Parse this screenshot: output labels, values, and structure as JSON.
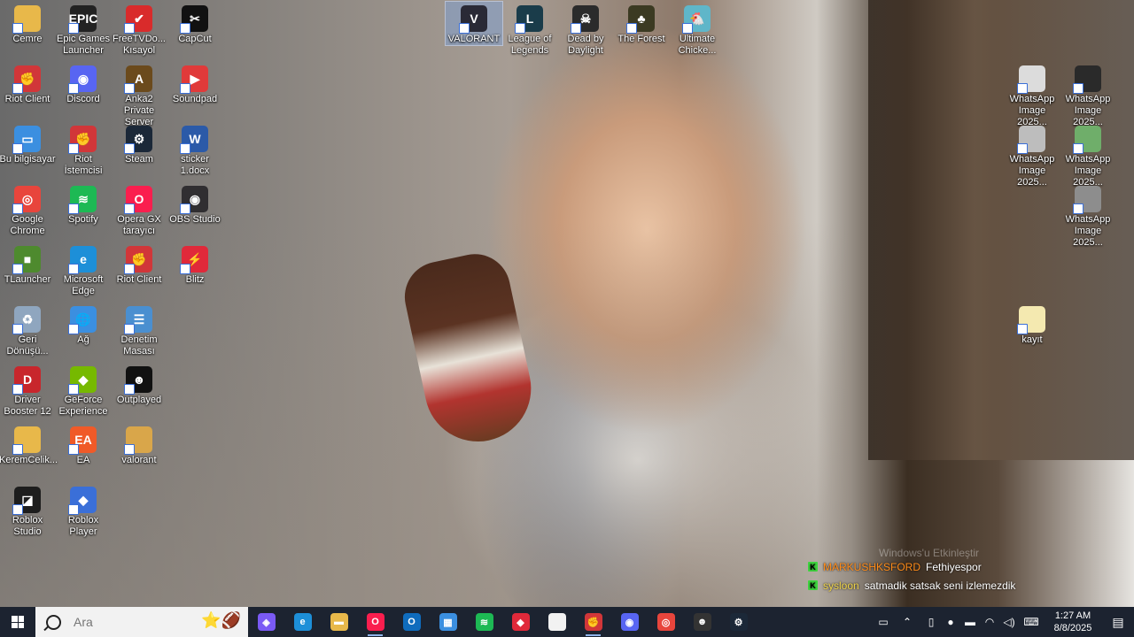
{
  "desktop": {
    "icons": [
      {
        "label": "Cemre",
        "icon": "folder-icon",
        "color": "#e8b84a",
        "glyph": "",
        "x": 0,
        "y": 0
      },
      {
        "label": "Epic Games Launcher",
        "icon": "epic-games-icon",
        "color": "#222222",
        "glyph": "EPIC",
        "x": 1,
        "y": 0
      },
      {
        "label": "FreeTVDo... Kısayol",
        "icon": "freetv-icon",
        "color": "#d92b2b",
        "glyph": "✔",
        "x": 2,
        "y": 0
      },
      {
        "label": "CapCut",
        "icon": "capcut-icon",
        "color": "#111111",
        "glyph": "✂",
        "x": 3,
        "y": 0
      },
      {
        "label": "VALORANT",
        "icon": "valorant-icon",
        "color": "#2a2a36",
        "glyph": "V",
        "x": 8,
        "y": 0,
        "selected": true
      },
      {
        "label": "League of Legends",
        "icon": "league-icon",
        "color": "#1a3c4a",
        "glyph": "L",
        "x": 9,
        "y": 0
      },
      {
        "label": "Dead by Daylight",
        "icon": "dbd-icon",
        "color": "#2b2b2b",
        "glyph": "☠",
        "x": 10,
        "y": 0
      },
      {
        "label": "The Forest",
        "icon": "the-forest-icon",
        "color": "#3b3a22",
        "glyph": "♣",
        "x": 11,
        "y": 0
      },
      {
        "label": "Ultimate Chicke...",
        "icon": "ultimate-chicken-icon",
        "color": "#5fb6c9",
        "glyph": "🐔",
        "x": 12,
        "y": 0
      },
      {
        "label": "Riot Client",
        "icon": "riot-client-icon",
        "color": "#d13639",
        "glyph": "✊",
        "x": 0,
        "y": 1
      },
      {
        "label": "Discord",
        "icon": "discord-icon",
        "color": "#5865f2",
        "glyph": "◉",
        "x": 1,
        "y": 1
      },
      {
        "label": "Anka2 Private Server",
        "icon": "anka2-icon",
        "color": "#6b4a1c",
        "glyph": "A",
        "x": 2,
        "y": 1
      },
      {
        "label": "Soundpad",
        "icon": "soundpad-icon",
        "color": "#e03a3a",
        "glyph": "▶",
        "x": 3,
        "y": 1
      },
      {
        "label": "Bu bilgisayar",
        "icon": "this-pc-icon",
        "color": "#3b8fe0",
        "glyph": "▭",
        "x": 0,
        "y": 2
      },
      {
        "label": "Riot İstemcisi",
        "icon": "riot-client-icon",
        "color": "#d13639",
        "glyph": "✊",
        "x": 1,
        "y": 2
      },
      {
        "label": "Steam",
        "icon": "steam-icon",
        "color": "#1b2838",
        "glyph": "⚙",
        "x": 2,
        "y": 2
      },
      {
        "label": "sticker 1.docx",
        "icon": "word-document-icon",
        "color": "#2b5aa8",
        "glyph": "W",
        "x": 3,
        "y": 2
      },
      {
        "label": "Google Chrome",
        "icon": "chrome-icon",
        "color": "#e8453c",
        "glyph": "◎",
        "x": 0,
        "y": 3
      },
      {
        "label": "Spotify",
        "icon": "spotify-icon",
        "color": "#1db954",
        "glyph": "≋",
        "x": 1,
        "y": 3
      },
      {
        "label": "Opera GX tarayıcı",
        "icon": "opera-gx-icon",
        "color": "#fa1e4e",
        "glyph": "O",
        "x": 2,
        "y": 3
      },
      {
        "label": "OBS Studio",
        "icon": "obs-icon",
        "color": "#302e31",
        "glyph": "◉",
        "x": 3,
        "y": 3
      },
      {
        "label": "TLauncher",
        "icon": "tlauncher-icon",
        "color": "#4e8a2e",
        "glyph": "■",
        "x": 0,
        "y": 4
      },
      {
        "label": "Microsoft Edge",
        "icon": "edge-icon",
        "color": "#1d8fd8",
        "glyph": "e",
        "x": 1,
        "y": 4
      },
      {
        "label": "Riot Client",
        "icon": "riot-client-icon",
        "color": "#d13639",
        "glyph": "✊",
        "x": 2,
        "y": 4
      },
      {
        "label": "Blitz",
        "icon": "blitz-icon",
        "color": "#e0293a",
        "glyph": "⚡",
        "x": 3,
        "y": 4
      },
      {
        "label": "Geri Dönüşü...",
        "icon": "recycle-bin-icon",
        "color": "#8fa6bf",
        "glyph": "♻",
        "x": 0,
        "y": 5
      },
      {
        "label": "Ağ",
        "icon": "network-icon",
        "color": "#3b8fe0",
        "glyph": "🌐",
        "x": 1,
        "y": 5
      },
      {
        "label": "Denetim Masası",
        "icon": "control-panel-icon",
        "color": "#4a8fd0",
        "glyph": "☰",
        "x": 2,
        "y": 5
      },
      {
        "label": "Driver Booster 12",
        "icon": "driver-booster-icon",
        "color": "#c8262c",
        "glyph": "D",
        "x": 0,
        "y": 6
      },
      {
        "label": "GeForce Experience",
        "icon": "geforce-icon",
        "color": "#76b900",
        "glyph": "◆",
        "x": 1,
        "y": 6
      },
      {
        "label": "Outplayed",
        "icon": "outplayed-icon",
        "color": "#111111",
        "glyph": "☻",
        "x": 2,
        "y": 6
      },
      {
        "label": "KeremCelik...",
        "icon": "folder-icon",
        "color": "#e8b84a",
        "glyph": "",
        "x": 0,
        "y": 7
      },
      {
        "label": "EA",
        "icon": "ea-icon",
        "color": "#f05a28",
        "glyph": "EA",
        "x": 1,
        "y": 7
      },
      {
        "label": "valorant",
        "icon": "folder-icon",
        "color": "#d9a64a",
        "glyph": "",
        "x": 2,
        "y": 7
      },
      {
        "label": "Roblox Studio",
        "icon": "roblox-studio-icon",
        "color": "#1d1d1d",
        "glyph": "◪",
        "x": 0,
        "y": 8
      },
      {
        "label": "Roblox Player",
        "icon": "roblox-player-icon",
        "color": "#3a6fd8",
        "glyph": "◆",
        "x": 1,
        "y": 8
      },
      {
        "label": "WhatsApp Image 2025...",
        "icon": "image-file-icon",
        "color": "#dcdcdc",
        "glyph": "",
        "x": 18,
        "y": 1
      },
      {
        "label": "WhatsApp Image 2025...",
        "icon": "image-file-icon",
        "color": "#2a2a2a",
        "glyph": "",
        "x": 19,
        "y": 1
      },
      {
        "label": "WhatsApp Image 2025...",
        "icon": "image-file-icon",
        "color": "#bdbdbd",
        "glyph": "",
        "x": 18,
        "y": 2
      },
      {
        "label": "WhatsApp Image 2025...",
        "icon": "image-file-icon",
        "color": "#6fae6a",
        "glyph": "",
        "x": 19,
        "y": 2
      },
      {
        "label": "WhatsApp Image 2025...",
        "icon": "image-file-icon",
        "color": "#8d8d8d",
        "glyph": "",
        "x": 19,
        "y": 3
      },
      {
        "label": "kayıt",
        "icon": "text-file-icon",
        "color": "#f4e9b0",
        "glyph": "",
        "x": 18,
        "y": 5
      }
    ]
  },
  "chat": {
    "lines": [
      {
        "user": "MARKUSHKSFORD",
        "message": "Fethiyespor"
      },
      {
        "user": "sysloon",
        "message": "satmadik satsak seni izlemezdik"
      }
    ],
    "watermark": "Windows'u Etkinleştir"
  },
  "taskbar": {
    "search_placeholder": "Ara",
    "apps": [
      {
        "icon": "copilot-icon",
        "color": "#7a5af5",
        "glyph": "◈"
      },
      {
        "icon": "edge-icon",
        "color": "#1d8fd8",
        "glyph": "e"
      },
      {
        "icon": "file-explorer-icon",
        "color": "#e8b84a",
        "glyph": "▬"
      },
      {
        "icon": "opera-gx-icon",
        "color": "#fa1e4e",
        "glyph": "O"
      },
      {
        "icon": "outlook-icon",
        "color": "#0f6cbd",
        "glyph": "O"
      },
      {
        "icon": "microsoft-store-icon",
        "color": "#3b8fe0",
        "glyph": "▦"
      },
      {
        "icon": "spotify-icon",
        "color": "#1db954",
        "glyph": "≋"
      },
      {
        "icon": "blitz-icon",
        "color": "#e0293a",
        "glyph": "◆"
      },
      {
        "icon": "notepad-icon",
        "color": "#f2f2f2",
        "glyph": ""
      },
      {
        "icon": "riot-client-icon",
        "color": "#d13639",
        "glyph": "✊"
      },
      {
        "icon": "discord-icon",
        "color": "#5865f2",
        "glyph": "◉"
      },
      {
        "icon": "chrome-icon",
        "color": "#e8453c",
        "glyph": "◎"
      },
      {
        "icon": "outplayed-icon",
        "color": "#333333",
        "glyph": "☻"
      },
      {
        "icon": "steam-icon",
        "color": "#1b2838",
        "glyph": "⚙"
      }
    ],
    "clock_time": "1:27 AM",
    "clock_date": "8/8/2025"
  }
}
